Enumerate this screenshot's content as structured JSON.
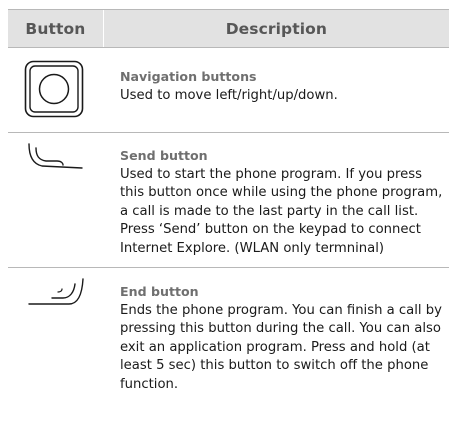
{
  "table": {
    "headers": {
      "button": "Button",
      "description": "Description"
    },
    "rows": [
      {
        "icon": "navigation-buttons-icon",
        "title": "Navigation buttons",
        "description": "Used to move left/right/up/down."
      },
      {
        "icon": "send-button-icon",
        "title": "Send button",
        "description": "Used to start the phone program. If you press this button once while using the phone program, a call is made to the last party in the call list. Press ‘Send’ button on the keypad to connect Internet Explore. (WLAN only termninal)"
      },
      {
        "icon": "end-button-icon",
        "title": "End button",
        "description": "Ends the phone program. You can finish a call by pressing this button during the call. You can also exit an application program. Press and hold (at least 5 sec) this button to switch off the phone function."
      }
    ]
  },
  "colors": {
    "header_bg": "#e2e2e2",
    "header_text": "#575757",
    "title_text": "#6f6f6f",
    "rule": "#b8b8b8"
  }
}
